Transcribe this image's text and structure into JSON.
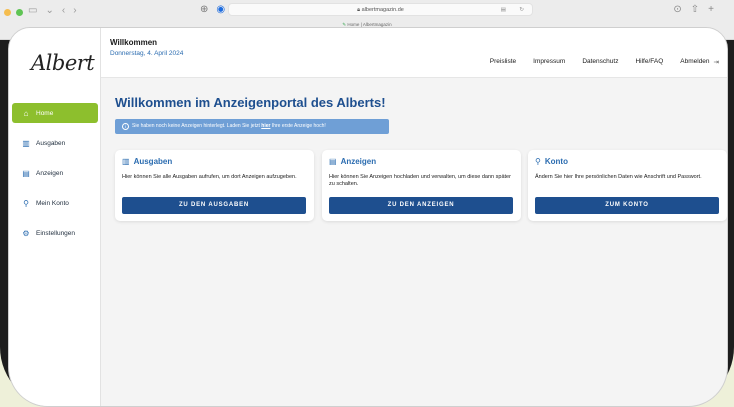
{
  "browser": {
    "url": "albertmagazin.de",
    "tab_title": "Home | Albertmagazin"
  },
  "app": {
    "logo": "Albert",
    "sidebar": {
      "items": [
        {
          "label": "Home",
          "icon": "home-icon"
        },
        {
          "label": "Ausgaben",
          "icon": "book-icon"
        },
        {
          "label": "Anzeigen",
          "icon": "document-icon"
        },
        {
          "label": "Mein Konto",
          "icon": "user-icon"
        },
        {
          "label": "Einstellungen",
          "icon": "gear-icon"
        }
      ]
    },
    "header": {
      "title": "Willkommen",
      "date": "Donnerstag, 4. April 2024",
      "nav": [
        "Preisliste",
        "Impressum",
        "Datenschutz",
        "Hilfe/FAQ",
        "Abmelden"
      ]
    },
    "main": {
      "heading": "Willkommen im Anzeigenportal des Alberts!",
      "alert_before": "Sie haben noch keine Anzeigen hinterlegt. Laden Sie jetzt ",
      "alert_link": "hier",
      "alert_after": " Ihre erste Anzeige hoch!",
      "cards": [
        {
          "title": "Ausgaben",
          "body": "Hier können Sie alle Ausgaben aufrufen, um dort Anzeigen aufzugeben.",
          "button": "ZU DEN AUSGABEN"
        },
        {
          "title": "Anzeigen",
          "body": "Hier können Sie Anzeigen hochladen und verwalten, um diese dann später zu schalten.",
          "button": "ZU DEN ANZEIGEN"
        },
        {
          "title": "Konto",
          "body": "Ändern Sie hier Ihre persönlichen Daten wie Anschrift und Passwort.",
          "button": "ZUM KONTO"
        }
      ]
    }
  },
  "colors": {
    "accent_green": "#8dbf2d",
    "primary_blue": "#1e4f8f",
    "link_blue": "#2b6cb0",
    "alert_blue": "#6f9fd6"
  }
}
